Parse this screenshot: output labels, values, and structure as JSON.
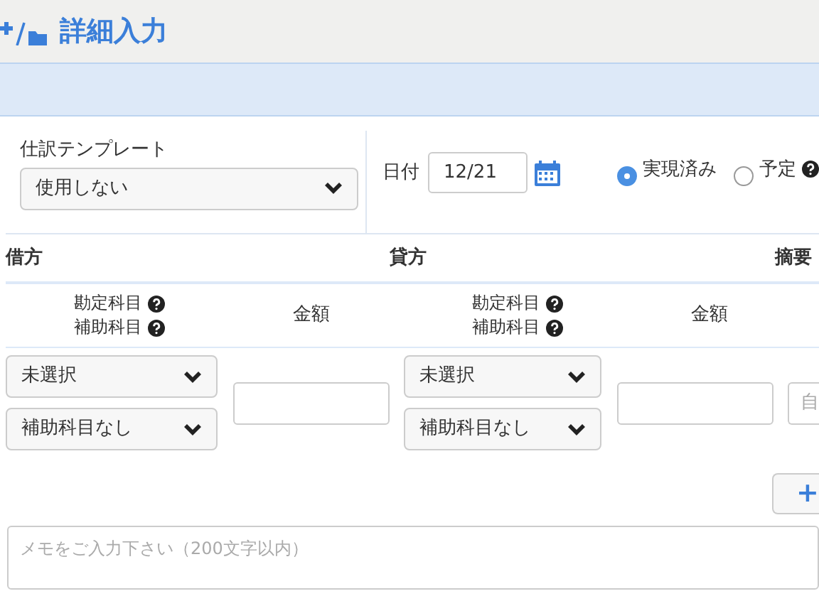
{
  "page_title": "詳細入力",
  "template": {
    "label": "仕訳テンプレート",
    "value": "使用しない"
  },
  "date": {
    "label": "日付",
    "value": "12/21"
  },
  "status_options": [
    {
      "label": "実現済み",
      "selected": true,
      "help": false
    },
    {
      "label": "予定",
      "selected": false,
      "help": true
    }
  ],
  "columns": [
    {
      "label": "借方"
    },
    {
      "label": "貸方"
    },
    {
      "label": "摘要"
    }
  ],
  "sides": [
    {
      "account_label": "勘定科目",
      "sub_account_label": "補助科目",
      "amount_label": "金額",
      "account_value": "未選択",
      "sub_account_value": "補助科目なし"
    },
    {
      "account_label": "勘定科目",
      "sub_account_label": "補助科目",
      "amount_label": "金額",
      "account_value": "未選択",
      "sub_account_value": "補助科目なし"
    }
  ],
  "description_field": {
    "placeholder": "自"
  },
  "add_button": {
    "label": "+"
  },
  "memo": {
    "placeholder": "メモをご入力下さい（200文字以内）"
  }
}
